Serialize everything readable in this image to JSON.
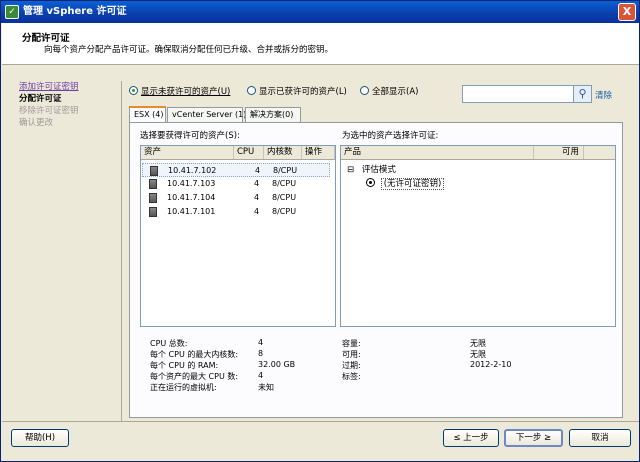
{
  "window": {
    "title": "管理 vSphere 许可证",
    "close": "X"
  },
  "header": {
    "title": "分配许可证",
    "subtitle": "向每个资产分配产品许可证。确保取消分配任何已升级、合并或拆分的密钥。"
  },
  "steps": [
    {
      "label": "添加许可证密钥",
      "state": "link"
    },
    {
      "label": "分配许可证",
      "state": "current"
    },
    {
      "label": "移除许可证密钥",
      "state": "disabled"
    },
    {
      "label": "确认更改",
      "state": "disabled"
    }
  ],
  "filter": {
    "options": [
      "显示未获许可的资产(U)",
      "显示已获许可的资产(L)",
      "全部显示(A)"
    ],
    "selected": "显示未获许可的资产(U)",
    "clear_label": "清除"
  },
  "tabs": [
    "ESX (4)",
    "vCenter Server (1)",
    "解决方案(0)"
  ],
  "left_pane": {
    "label": "选择要获得许可的资产(S):",
    "columns": [
      "资产",
      "CPU",
      "内核数",
      "操作"
    ],
    "rows": [
      {
        "asset": "10.41.7.102",
        "cpu": "4",
        "cores": "8/CPU"
      },
      {
        "asset": "10.41.7.103",
        "cpu": "4",
        "cores": "8/CPU"
      },
      {
        "asset": "10.41.7.104",
        "cpu": "4",
        "cores": "8/CPU"
      },
      {
        "asset": "10.41.7.101",
        "cpu": "4",
        "cores": "8/CPU"
      }
    ]
  },
  "right_pane": {
    "label": "为选中的资产选择许可证:",
    "columns": [
      "产品",
      "可用"
    ],
    "tree": {
      "expander": "⊟",
      "group": "评估模式",
      "item": "(无许可证密钥)"
    }
  },
  "details_left": [
    {
      "k": "CPU 总数:",
      "v": "4"
    },
    {
      "k": "每个 CPU 的最大内核数:",
      "v": "8"
    },
    {
      "k": "每个 CPU 的 RAM:",
      "v": "32.00 GB"
    },
    {
      "k": "每个资产的最大 CPU 数:",
      "v": "4"
    },
    {
      "k": "正在运行的虚拟机:",
      "v": "未知"
    }
  ],
  "details_right": [
    {
      "k": "容量:",
      "v": "无限"
    },
    {
      "k": "可用:",
      "v": "无限"
    },
    {
      "k": "过期:",
      "v": "2012-2-10"
    },
    {
      "k": "标签:",
      "v": ""
    }
  ],
  "buttons": {
    "help": "帮助(H)",
    "back": "≤ 上一步",
    "next": "下一步 ≥",
    "cancel": "取消"
  }
}
